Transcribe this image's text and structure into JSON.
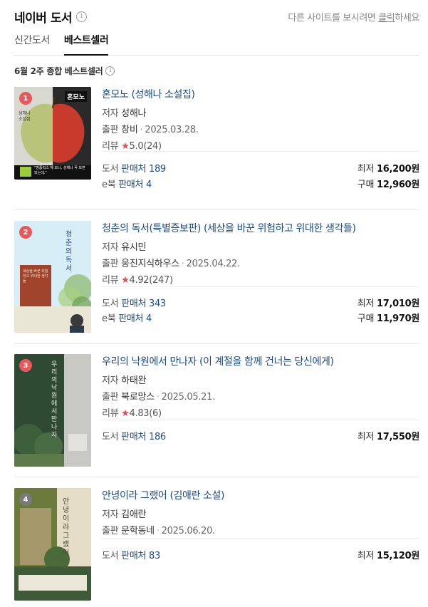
{
  "header": {
    "title": "네이버 도서",
    "info_icon": "i",
    "other_prefix": "다른 사이트를 보시려면 ",
    "other_click": "클릭",
    "other_suffix": "하세요"
  },
  "tabs": [
    {
      "label": "신간도서",
      "active": false
    },
    {
      "label": "베스트셀러",
      "active": true
    }
  ],
  "subtitle": "6월 2주 종합 베스트셀러",
  "colors": {
    "rank_red": "#e8585b",
    "rank_gray": "#7a7a7a",
    "link": "#1a4a8a",
    "star": "#e84a4a"
  },
  "books": [
    {
      "rank": "1",
      "title": "혼모노 (성해나 소설집)",
      "author_label": "저자",
      "author": "성해나",
      "publisher_label": "출판",
      "publisher": "창비",
      "date": "2025.03.28.",
      "review_label": "리뷰",
      "rating": "5.0",
      "review_count": "(24)",
      "book_label": "도서",
      "book_shops": "판매처 189",
      "book_min_label": "최저",
      "book_min": "16,200원",
      "ebook_label": "e북",
      "ebook_shops": "판매처 4",
      "ebook_label2": "구매",
      "ebook_price": "12,960원",
      "cover_title": "혼모노",
      "cover_author": "성해나 소설집",
      "cover_quote": "\"명품럭스 해 보니, 성해나 꼭 보면 되는데.\""
    },
    {
      "rank": "2",
      "title": "청춘의 독서(특별증보판) (세상을 바꾼 위험하고 위대한 생각들)",
      "author_label": "저자",
      "author": "유시민",
      "publisher_label": "출판",
      "publisher": "웅진지식하우스",
      "date": "2025.04.22.",
      "review_label": "리뷰",
      "rating": "4.92",
      "review_count": "(247)",
      "book_label": "도서",
      "book_shops": "판매처 343",
      "book_min_label": "최저",
      "book_min": "17,010원",
      "ebook_label": "e북",
      "ebook_shops": "판매처 4",
      "ebook_label2": "구매",
      "ebook_price": "11,970원",
      "cover_title": "청춘의 독서",
      "cover_sub": "세상을 바꾼 위험하고 위대한 생각들"
    },
    {
      "rank": "3",
      "title": "우리의 낙원에서 만나자 (이 계절을 함께 건너는 당신에게)",
      "author_label": "저자",
      "author": "하태완",
      "publisher_label": "출판",
      "publisher": "북로망스",
      "date": "2025.05.21.",
      "review_label": "리뷰",
      "rating": "4.83",
      "review_count": "(6)",
      "book_label": "도서",
      "book_shops": "판매처 186",
      "book_min_label": "최저",
      "book_min": "17,550원",
      "cover_title": "우리의 낙원에서 만나자"
    },
    {
      "rank": "4",
      "title": "안녕이라 그랬어 (김애란 소설)",
      "author_label": "저자",
      "author": "김애란",
      "publisher_label": "출판",
      "publisher": "문학동네",
      "date": "2025.06.20.",
      "book_label": "도서",
      "book_shops": "판매처 83",
      "book_min_label": "최저",
      "book_min": "15,120원",
      "cover_title": "안녕이라 그랬어"
    }
  ]
}
